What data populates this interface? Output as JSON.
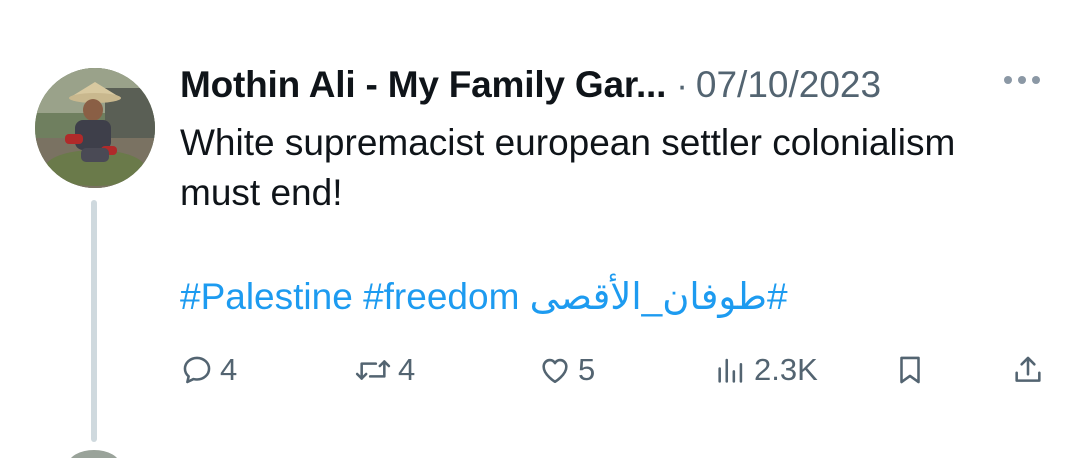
{
  "tweet": {
    "author_name": "Mothin Ali - My Family Gar...",
    "separator": "·",
    "date": "07/10/2023",
    "text": "White supremacist european settler colonialism must end!",
    "hashtags": [
      "#Palestine",
      "#freedom",
      "#طوفان_الأقصى"
    ],
    "more_icon": "more-horizontal-icon"
  },
  "actions": {
    "reply": {
      "icon": "reply-icon",
      "count": "4"
    },
    "retweet": {
      "icon": "retweet-icon",
      "count": "4"
    },
    "like": {
      "icon": "heart-icon",
      "count": "5"
    },
    "views": {
      "icon": "views-chart-icon",
      "count": "2.3K"
    },
    "bookmark": {
      "icon": "bookmark-icon"
    },
    "share": {
      "icon": "share-icon"
    }
  },
  "colors": {
    "link": "#1d9bf0",
    "secondary_text": "#536471",
    "thread_line": "#cfd9de"
  }
}
